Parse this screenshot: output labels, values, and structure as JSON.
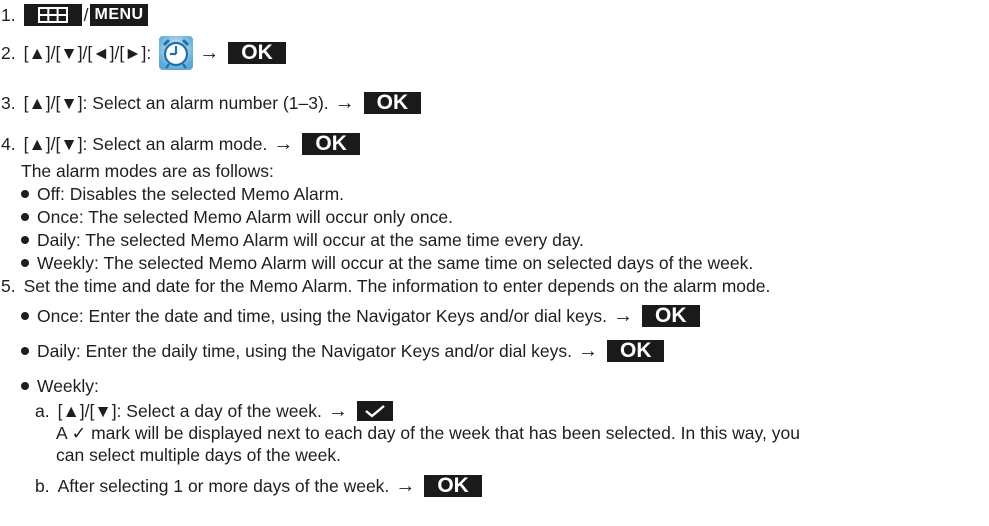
{
  "steps": {
    "s1": {
      "num": "1.",
      "sep": "/",
      "menu": "MENU"
    },
    "s2": {
      "num": "2.",
      "text": "[▲]/[▼]/[◄]/[►]:",
      "arrow": "→",
      "ok": "OK"
    },
    "s3": {
      "num": "3.",
      "text": "[▲]/[▼]: Select an alarm number (1–3).",
      "arrow": "→",
      "ok": "OK"
    },
    "s4": {
      "num": "4.",
      "text": "[▲]/[▼]: Select an alarm mode.",
      "arrow": "→",
      "ok": "OK"
    },
    "modes_intro": "The alarm modes are as follows:",
    "modes": [
      "Off: Disables the selected Memo Alarm.",
      "Once: The selected Memo Alarm will occur only once.",
      "Daily: The selected Memo Alarm will occur at the same time every day.",
      "Weekly: The selected Memo Alarm will occur at the same time on selected days of the week."
    ],
    "s5": {
      "num": "5.",
      "text": "Set the time and date for the Memo Alarm. The information to enter depends on the alarm mode.",
      "once": "Once: Enter the date and time, using the Navigator Keys and/or dial keys.",
      "daily": "Daily: Enter the daily time, using the Navigator Keys and/or dial keys.",
      "weekly": "Weekly:",
      "a_label": "a.",
      "a_text": "[▲]/[▼]: Select a day of the week.",
      "a_note1": "A ✓ mark will be displayed next to each day of the week that has been selected. In this way, you",
      "a_note2": "can select multiple days of the week.",
      "b_label": "b.",
      "b_text": "After selecting 1 or more days of the week.",
      "arrow": "→",
      "ok": "OK"
    }
  },
  "colors": {
    "key_bg": "#1a1a1a",
    "text": "#1e1e1e"
  },
  "icons": [
    "menu-grid-icon",
    "alarm-clock-icon",
    "check-icon"
  ]
}
